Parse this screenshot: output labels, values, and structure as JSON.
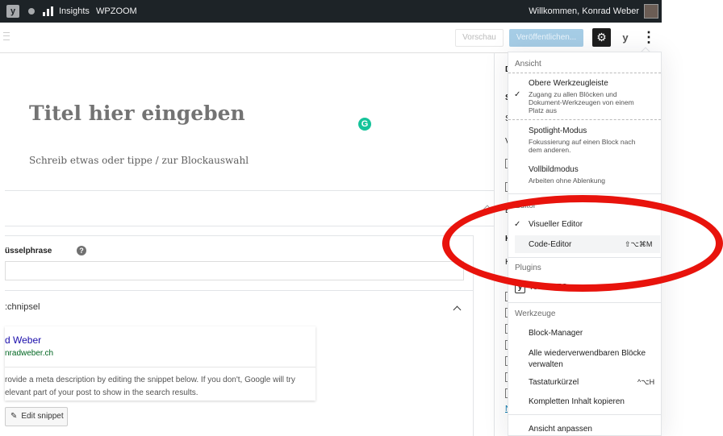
{
  "admin_bar": {
    "insights_label": "Insights",
    "site_label": "WPZOOM",
    "greeting": "Willkommen, Konrad Weber",
    "yoast_glyph": "y",
    "icons": [
      "yoast-icon",
      "dot-icon",
      "bars-icon",
      "avatar"
    ]
  },
  "editor_header": {
    "preview_label": "Vorschau",
    "publish_label": "Veröffentlichen...",
    "settings_icon": "gear-icon",
    "yoast_icon_glyph": "y",
    "more_icon_glyph": "⋮"
  },
  "content": {
    "title_placeholder": "Titel hier eingeben",
    "grammarly_glyph": "G",
    "block_placeholder": "Schreib etwas oder tippe / zur Blockauswahl"
  },
  "yoast_metabox": {
    "keyphrase_label": "üsselphrase",
    "help_glyph": "?",
    "snippet_section_label": ":chnipsel",
    "serp_title": "d Weber",
    "serp_url": "nradweber.ch",
    "serp_description": "rovide a meta description by editing the snippet below. If you don't, Google will try\nelevant part of your post to show in the search results.",
    "edit_snippet_label": "Edit snippet",
    "pen_icon": "pencil-icon"
  },
  "settings_sidebar": {
    "fragments": [
      "D",
      "S",
      "S",
      "V",
      "E",
      "K",
      "K",
      "N"
    ]
  },
  "dropdown": {
    "group_view": "Ansicht",
    "top_toolbar": {
      "label": "Obere Werkzeugleiste",
      "help": "Zugang zu allen Blöcken und Dokument-Werkzeugen von einem Platz aus",
      "checked": true
    },
    "spotlight": {
      "label": "Spotlight-Modus",
      "help": "Fokussierung auf einen Block nach dem anderen."
    },
    "fullscreen": {
      "label": "Vollbildmodus",
      "help": "Arbeiten ohne Ablenkung"
    },
    "group_editor": "Editor",
    "visual_editor": {
      "label": "Visueller Editor",
      "checked": true
    },
    "code_editor": {
      "label": "Code-Editor",
      "shortcut": "⇧⌥⌘M"
    },
    "group_plugins": "Plugins",
    "yoast_seo": {
      "label": "Yoast SEO",
      "glyph": "y"
    },
    "group_tools": "Werkzeuge",
    "block_manager": "Block-Manager",
    "reusable_blocks": "Alle wiederverwendbaren Blöcke verwalten",
    "shortcuts": {
      "label": "Tastaturkürzel",
      "shortcut": "^⌥H"
    },
    "copy_content": "Kompletten Inhalt kopieren",
    "customize_view": "Ansicht anpassen",
    "check_glyph": "✓"
  },
  "colors": {
    "annotation": "#e8130c",
    "admin_bar": "#1d2327",
    "publish_button": "#a6cde6",
    "grammarly": "#15c39a",
    "serp_title": "#1a0dab",
    "serp_url": "#006621"
  }
}
